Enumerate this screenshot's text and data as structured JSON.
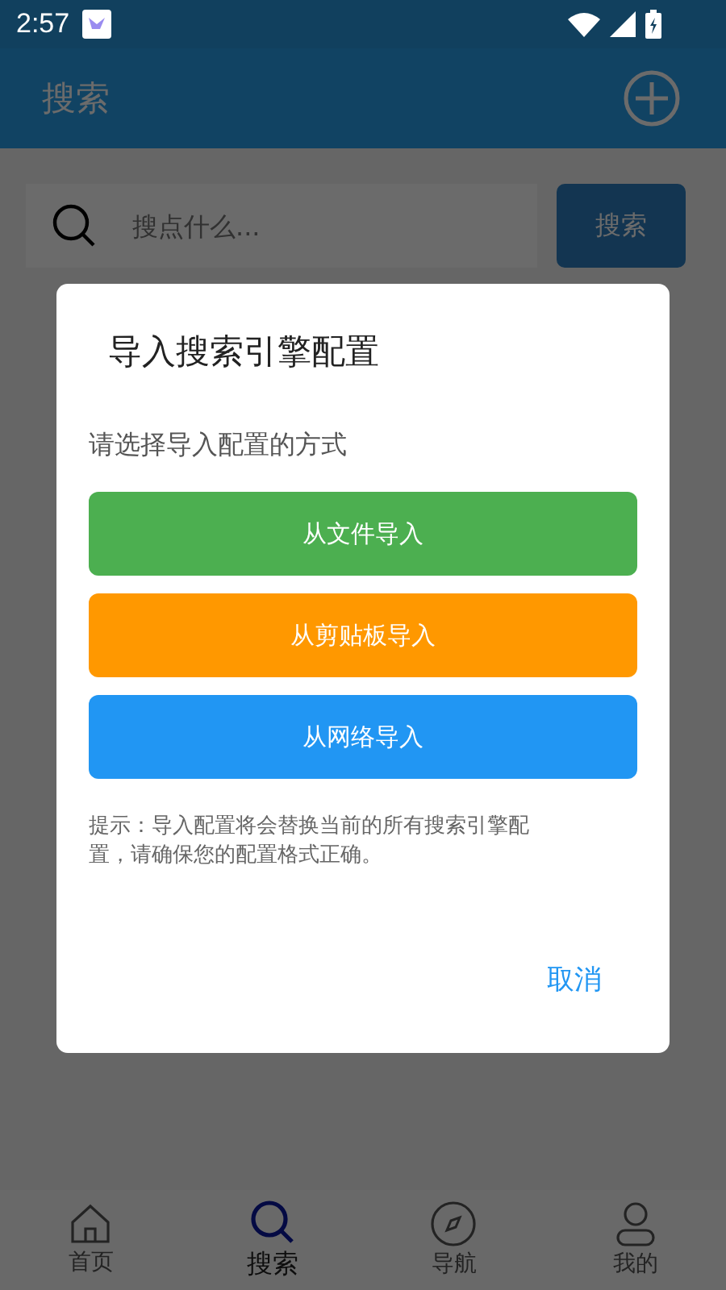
{
  "status_bar": {
    "time": "2:57"
  },
  "header": {
    "title": "搜索"
  },
  "search": {
    "placeholder": "搜点什么...",
    "button": "搜索"
  },
  "dialog": {
    "title": "导入搜索引擎配置",
    "subtitle": "请选择导入配置的方式",
    "options": [
      {
        "label": "从文件导入",
        "color": "#4caf50"
      },
      {
        "label": "从剪贴板导入",
        "color": "#ff9800"
      },
      {
        "label": "从网络导入",
        "color": "#2196f3"
      }
    ],
    "hint": "提示：导入配置将会替换当前的所有搜索引擎配置，请确保您的配置格式正确。",
    "cancel": "取消"
  },
  "bottom_nav": [
    {
      "label": "首页",
      "kind": "home",
      "selected": false
    },
    {
      "label": "搜索",
      "kind": "search",
      "selected": true
    },
    {
      "label": "导航",
      "kind": "compass",
      "selected": false
    },
    {
      "label": "我的",
      "kind": "person",
      "selected": false
    }
  ]
}
